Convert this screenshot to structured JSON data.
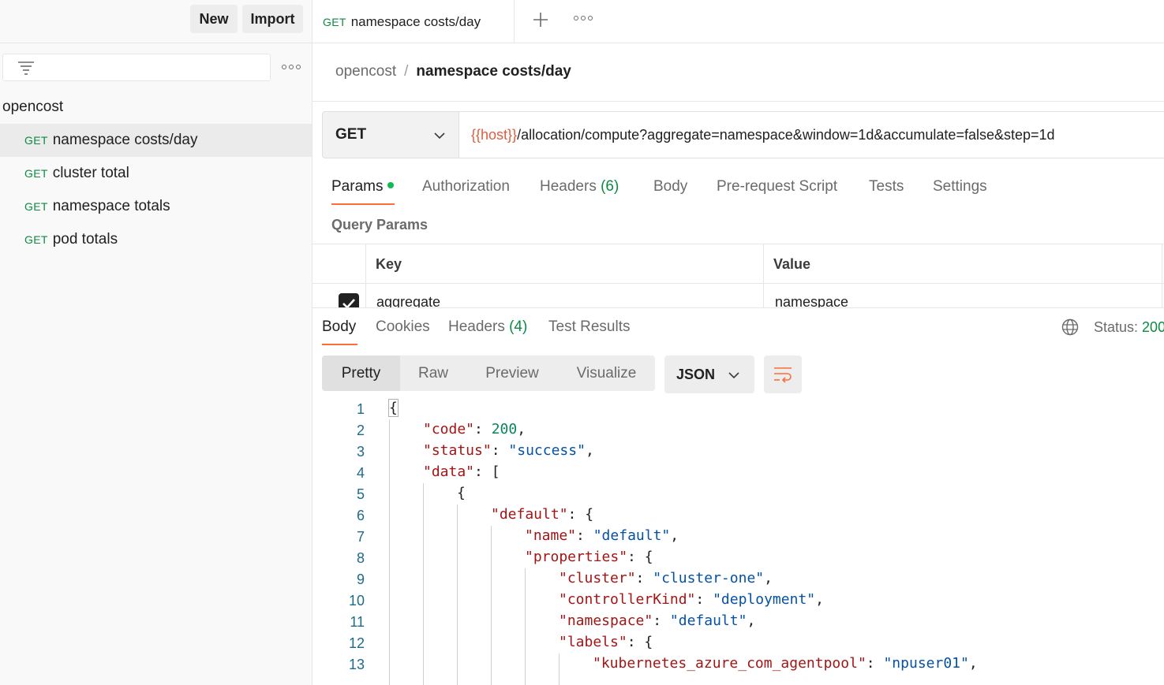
{
  "sidebar": {
    "new_label": "New",
    "import_label": "Import",
    "collection_name": "opencost",
    "items": [
      {
        "method": "GET",
        "label": "namespace costs/day",
        "active": true
      },
      {
        "method": "GET",
        "label": "cluster total",
        "active": false
      },
      {
        "method": "GET",
        "label": "namespace totals",
        "active": false
      },
      {
        "method": "GET",
        "label": "pod totals",
        "active": false
      }
    ]
  },
  "tab": {
    "method": "GET",
    "label": "namespace costs/day"
  },
  "breadcrumb": {
    "parent": "opencost",
    "separator": "/",
    "current": "namespace costs/day"
  },
  "request": {
    "method": "GET",
    "url_variable": "{{host}}",
    "url_path": "/allocation/compute?aggregate=namespace&window=1d&accumulate=false&step=1d",
    "tabs": {
      "params": "Params",
      "authorization": "Authorization",
      "headers": "Headers",
      "headers_count": "(6)",
      "body": "Body",
      "prerequest": "Pre-request Script",
      "tests": "Tests",
      "settings": "Settings"
    },
    "query_params_title": "Query Params",
    "columns": {
      "key": "Key",
      "value": "Value"
    },
    "params": [
      {
        "key": "aggregate",
        "value": "namespace",
        "checked": true
      }
    ]
  },
  "response": {
    "tabs": {
      "body": "Body",
      "cookies": "Cookies",
      "headers": "Headers",
      "headers_count": "(4)",
      "tests": "Test Results"
    },
    "status_label": "Status:",
    "status_value": "200",
    "views": {
      "pretty": "Pretty",
      "raw": "Raw",
      "preview": "Preview",
      "visualize": "Visualize"
    },
    "format": "JSON",
    "code_lines": [
      {
        "n": "1",
        "indent": 0,
        "parts": [
          [
            "p",
            "{"
          ]
        ]
      },
      {
        "n": "2",
        "indent": 1,
        "parts": [
          [
            "k",
            "\"code\""
          ],
          [
            "p",
            ": "
          ],
          [
            "n",
            "200"
          ],
          [
            "p",
            ","
          ]
        ]
      },
      {
        "n": "3",
        "indent": 1,
        "parts": [
          [
            "k",
            "\"status\""
          ],
          [
            "p",
            ": "
          ],
          [
            "s",
            "\"success\""
          ],
          [
            "p",
            ","
          ]
        ]
      },
      {
        "n": "4",
        "indent": 1,
        "parts": [
          [
            "k",
            "\"data\""
          ],
          [
            "p",
            ": ["
          ]
        ]
      },
      {
        "n": "5",
        "indent": 2,
        "parts": [
          [
            "p",
            "{"
          ]
        ]
      },
      {
        "n": "6",
        "indent": 3,
        "parts": [
          [
            "k",
            "\"default\""
          ],
          [
            "p",
            ": {"
          ]
        ]
      },
      {
        "n": "7",
        "indent": 4,
        "parts": [
          [
            "k",
            "\"name\""
          ],
          [
            "p",
            ": "
          ],
          [
            "s",
            "\"default\""
          ],
          [
            "p",
            ","
          ]
        ]
      },
      {
        "n": "8",
        "indent": 4,
        "parts": [
          [
            "k",
            "\"properties\""
          ],
          [
            "p",
            ": {"
          ]
        ]
      },
      {
        "n": "9",
        "indent": 5,
        "parts": [
          [
            "k",
            "\"cluster\""
          ],
          [
            "p",
            ": "
          ],
          [
            "s",
            "\"cluster-one\""
          ],
          [
            "p",
            ","
          ]
        ]
      },
      {
        "n": "10",
        "indent": 5,
        "parts": [
          [
            "k",
            "\"controllerKind\""
          ],
          [
            "p",
            ": "
          ],
          [
            "s",
            "\"deployment\""
          ],
          [
            "p",
            ","
          ]
        ]
      },
      {
        "n": "11",
        "indent": 5,
        "parts": [
          [
            "k",
            "\"namespace\""
          ],
          [
            "p",
            ": "
          ],
          [
            "s",
            "\"default\""
          ],
          [
            "p",
            ","
          ]
        ]
      },
      {
        "n": "12",
        "indent": 5,
        "parts": [
          [
            "k",
            "\"labels\""
          ],
          [
            "p",
            ": {"
          ]
        ]
      },
      {
        "n": "13",
        "indent": 6,
        "parts": [
          [
            "k",
            "\"kubernetes_azure_com_agentpool\""
          ],
          [
            "p",
            ": "
          ],
          [
            "s",
            "\"npuser01\""
          ],
          [
            "p",
            ","
          ]
        ]
      }
    ]
  },
  "colors": {
    "accent": "#ff6c37",
    "method_get": "#0b8a43",
    "url_variable": "#e05c3e",
    "json_key": "#a31515",
    "json_string": "#0451a5",
    "json_number": "#098658"
  },
  "icons": [
    "filter-icon",
    "more-icon",
    "plus-icon",
    "chevron-down-icon",
    "globe-icon",
    "wrap-lines-icon",
    "checkbox-checked-icon"
  ]
}
